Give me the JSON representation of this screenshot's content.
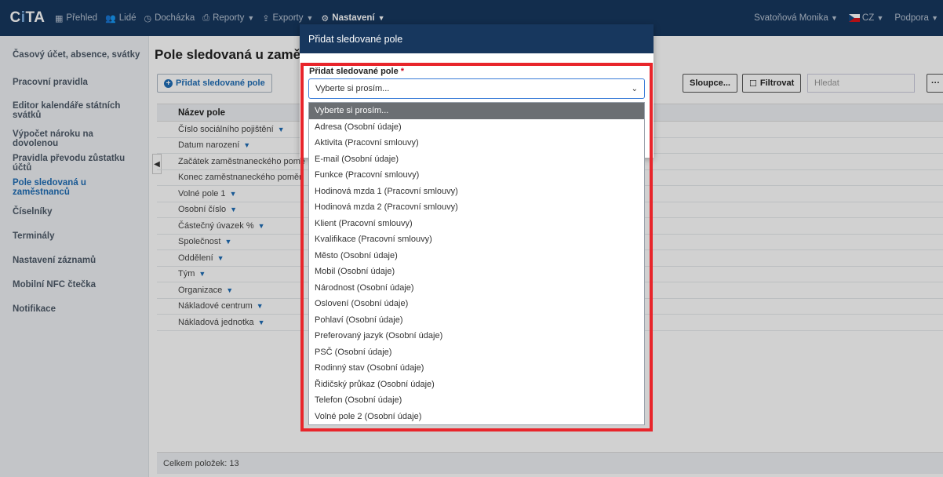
{
  "nav": {
    "logo": "CiTA",
    "items": [
      {
        "icon": "grid-icon",
        "label": "Přehled",
        "caret": false
      },
      {
        "icon": "users-icon",
        "label": "Lidé",
        "caret": false
      },
      {
        "icon": "clock-icon",
        "label": "Docházka",
        "caret": false
      },
      {
        "icon": "printer-icon",
        "label": "Reporty",
        "caret": true
      },
      {
        "icon": "export-icon",
        "label": "Exporty",
        "caret": true
      },
      {
        "icon": "gear-icon",
        "label": "Nastavení",
        "caret": true
      }
    ],
    "user": "Svatoňová Monika",
    "language": "CZ",
    "support": "Podpora"
  },
  "sidebar": {
    "items": [
      "Časový účet, absence, svátky",
      "Pracovní pravidla",
      "Editor kalendáře státních svátků",
      "Výpočet nároku na dovolenou",
      "Pravidla převodu zůstatku účtů",
      "Pole sledovaná u zaměstnanců",
      "Číselníky",
      "Terminály",
      "Nastavení záznamů",
      "Mobilní NFC čtečka",
      "Notifikace"
    ],
    "active_index": 5
  },
  "main": {
    "title": "Pole sledovaná u zaměs",
    "add_button": "Přidat sledované pole",
    "columns_button": "Sloupce...",
    "filter_button": "Filtrovat",
    "search_placeholder": "Hledat",
    "more_button": "···",
    "table": {
      "header": "Název pole",
      "rows": [
        "Číslo sociálního pojištění",
        "Datum narození",
        "Začátek zaměstnaneckého pomě",
        "Konec zaměstnaneckého poměr",
        "Volné pole 1",
        "Osobní číslo",
        "Částečný úvazek %",
        "Společnost",
        "Oddělení",
        "Tým",
        "Organizace",
        "Nákladové centrum",
        "Nákladová jednotka"
      ],
      "rows_with_caret": [
        true,
        true,
        false,
        false,
        true,
        true,
        true,
        true,
        true,
        true,
        true,
        true,
        true
      ],
      "footer": "Celkem položek: 13"
    }
  },
  "modal": {
    "title": "Přidat sledované pole",
    "field_label": "Přidat sledované pole",
    "required_mark": "*",
    "select_value": "Vyberte si prosím...",
    "options": [
      "Vyberte si prosím...",
      "Adresa (Osobní údaje)",
      "Aktivita (Pracovní smlouvy)",
      "E-mail (Osobní údaje)",
      "Funkce (Pracovní smlouvy)",
      "Hodinová mzda 1 (Pracovní smlouvy)",
      "Hodinová mzda 2 (Pracovní smlouvy)",
      "Klient (Pracovní smlouvy)",
      "Kvalifikace (Pracovní smlouvy)",
      "Město (Osobní údaje)",
      "Mobil (Osobní údaje)",
      "Národnost (Osobní údaje)",
      "Oslovení (Osobní údaje)",
      "Pohlaví (Osobní údaje)",
      "Preferovaný jazyk (Osobní údaje)",
      "PSČ (Osobní údaje)",
      "Rodinný stav (Osobní údaje)",
      "Řidičský průkaz (Osobní údaje)",
      "Telefon (Osobní údaje)",
      "Volné pole 2 (Osobní údaje)"
    ],
    "selected_index": 0
  },
  "colors": {
    "navbar": "#17375e",
    "accent": "#1f6db5",
    "highlight": "#e8252b",
    "selected_option": "#6b6f73"
  }
}
